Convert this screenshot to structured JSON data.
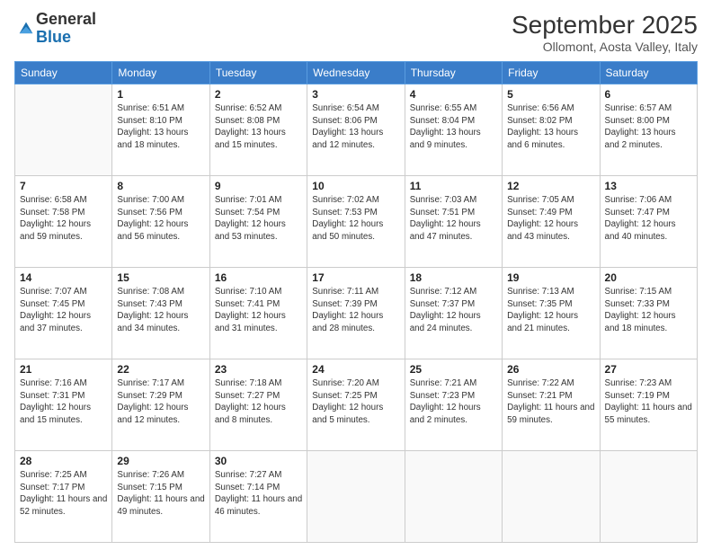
{
  "logo": {
    "general": "General",
    "blue": "Blue"
  },
  "header": {
    "month_title": "September 2025",
    "location": "Ollomont, Aosta Valley, Italy"
  },
  "days_of_week": [
    "Sunday",
    "Monday",
    "Tuesday",
    "Wednesday",
    "Thursday",
    "Friday",
    "Saturday"
  ],
  "weeks": [
    [
      {
        "day": "",
        "sunrise": "",
        "sunset": "",
        "daylight": ""
      },
      {
        "day": "1",
        "sunrise": "Sunrise: 6:51 AM",
        "sunset": "Sunset: 8:10 PM",
        "daylight": "Daylight: 13 hours and 18 minutes."
      },
      {
        "day": "2",
        "sunrise": "Sunrise: 6:52 AM",
        "sunset": "Sunset: 8:08 PM",
        "daylight": "Daylight: 13 hours and 15 minutes."
      },
      {
        "day": "3",
        "sunrise": "Sunrise: 6:54 AM",
        "sunset": "Sunset: 8:06 PM",
        "daylight": "Daylight: 13 hours and 12 minutes."
      },
      {
        "day": "4",
        "sunrise": "Sunrise: 6:55 AM",
        "sunset": "Sunset: 8:04 PM",
        "daylight": "Daylight: 13 hours and 9 minutes."
      },
      {
        "day": "5",
        "sunrise": "Sunrise: 6:56 AM",
        "sunset": "Sunset: 8:02 PM",
        "daylight": "Daylight: 13 hours and 6 minutes."
      },
      {
        "day": "6",
        "sunrise": "Sunrise: 6:57 AM",
        "sunset": "Sunset: 8:00 PM",
        "daylight": "Daylight: 13 hours and 2 minutes."
      }
    ],
    [
      {
        "day": "7",
        "sunrise": "Sunrise: 6:58 AM",
        "sunset": "Sunset: 7:58 PM",
        "daylight": "Daylight: 12 hours and 59 minutes."
      },
      {
        "day": "8",
        "sunrise": "Sunrise: 7:00 AM",
        "sunset": "Sunset: 7:56 PM",
        "daylight": "Daylight: 12 hours and 56 minutes."
      },
      {
        "day": "9",
        "sunrise": "Sunrise: 7:01 AM",
        "sunset": "Sunset: 7:54 PM",
        "daylight": "Daylight: 12 hours and 53 minutes."
      },
      {
        "day": "10",
        "sunrise": "Sunrise: 7:02 AM",
        "sunset": "Sunset: 7:53 PM",
        "daylight": "Daylight: 12 hours and 50 minutes."
      },
      {
        "day": "11",
        "sunrise": "Sunrise: 7:03 AM",
        "sunset": "Sunset: 7:51 PM",
        "daylight": "Daylight: 12 hours and 47 minutes."
      },
      {
        "day": "12",
        "sunrise": "Sunrise: 7:05 AM",
        "sunset": "Sunset: 7:49 PM",
        "daylight": "Daylight: 12 hours and 43 minutes."
      },
      {
        "day": "13",
        "sunrise": "Sunrise: 7:06 AM",
        "sunset": "Sunset: 7:47 PM",
        "daylight": "Daylight: 12 hours and 40 minutes."
      }
    ],
    [
      {
        "day": "14",
        "sunrise": "Sunrise: 7:07 AM",
        "sunset": "Sunset: 7:45 PM",
        "daylight": "Daylight: 12 hours and 37 minutes."
      },
      {
        "day": "15",
        "sunrise": "Sunrise: 7:08 AM",
        "sunset": "Sunset: 7:43 PM",
        "daylight": "Daylight: 12 hours and 34 minutes."
      },
      {
        "day": "16",
        "sunrise": "Sunrise: 7:10 AM",
        "sunset": "Sunset: 7:41 PM",
        "daylight": "Daylight: 12 hours and 31 minutes."
      },
      {
        "day": "17",
        "sunrise": "Sunrise: 7:11 AM",
        "sunset": "Sunset: 7:39 PM",
        "daylight": "Daylight: 12 hours and 28 minutes."
      },
      {
        "day": "18",
        "sunrise": "Sunrise: 7:12 AM",
        "sunset": "Sunset: 7:37 PM",
        "daylight": "Daylight: 12 hours and 24 minutes."
      },
      {
        "day": "19",
        "sunrise": "Sunrise: 7:13 AM",
        "sunset": "Sunset: 7:35 PM",
        "daylight": "Daylight: 12 hours and 21 minutes."
      },
      {
        "day": "20",
        "sunrise": "Sunrise: 7:15 AM",
        "sunset": "Sunset: 7:33 PM",
        "daylight": "Daylight: 12 hours and 18 minutes."
      }
    ],
    [
      {
        "day": "21",
        "sunrise": "Sunrise: 7:16 AM",
        "sunset": "Sunset: 7:31 PM",
        "daylight": "Daylight: 12 hours and 15 minutes."
      },
      {
        "day": "22",
        "sunrise": "Sunrise: 7:17 AM",
        "sunset": "Sunset: 7:29 PM",
        "daylight": "Daylight: 12 hours and 12 minutes."
      },
      {
        "day": "23",
        "sunrise": "Sunrise: 7:18 AM",
        "sunset": "Sunset: 7:27 PM",
        "daylight": "Daylight: 12 hours and 8 minutes."
      },
      {
        "day": "24",
        "sunrise": "Sunrise: 7:20 AM",
        "sunset": "Sunset: 7:25 PM",
        "daylight": "Daylight: 12 hours and 5 minutes."
      },
      {
        "day": "25",
        "sunrise": "Sunrise: 7:21 AM",
        "sunset": "Sunset: 7:23 PM",
        "daylight": "Daylight: 12 hours and 2 minutes."
      },
      {
        "day": "26",
        "sunrise": "Sunrise: 7:22 AM",
        "sunset": "Sunset: 7:21 PM",
        "daylight": "Daylight: 11 hours and 59 minutes."
      },
      {
        "day": "27",
        "sunrise": "Sunrise: 7:23 AM",
        "sunset": "Sunset: 7:19 PM",
        "daylight": "Daylight: 11 hours and 55 minutes."
      }
    ],
    [
      {
        "day": "28",
        "sunrise": "Sunrise: 7:25 AM",
        "sunset": "Sunset: 7:17 PM",
        "daylight": "Daylight: 11 hours and 52 minutes."
      },
      {
        "day": "29",
        "sunrise": "Sunrise: 7:26 AM",
        "sunset": "Sunset: 7:15 PM",
        "daylight": "Daylight: 11 hours and 49 minutes."
      },
      {
        "day": "30",
        "sunrise": "Sunrise: 7:27 AM",
        "sunset": "Sunset: 7:14 PM",
        "daylight": "Daylight: 11 hours and 46 minutes."
      },
      {
        "day": "",
        "sunrise": "",
        "sunset": "",
        "daylight": ""
      },
      {
        "day": "",
        "sunrise": "",
        "sunset": "",
        "daylight": ""
      },
      {
        "day": "",
        "sunrise": "",
        "sunset": "",
        "daylight": ""
      },
      {
        "day": "",
        "sunrise": "",
        "sunset": "",
        "daylight": ""
      }
    ]
  ]
}
